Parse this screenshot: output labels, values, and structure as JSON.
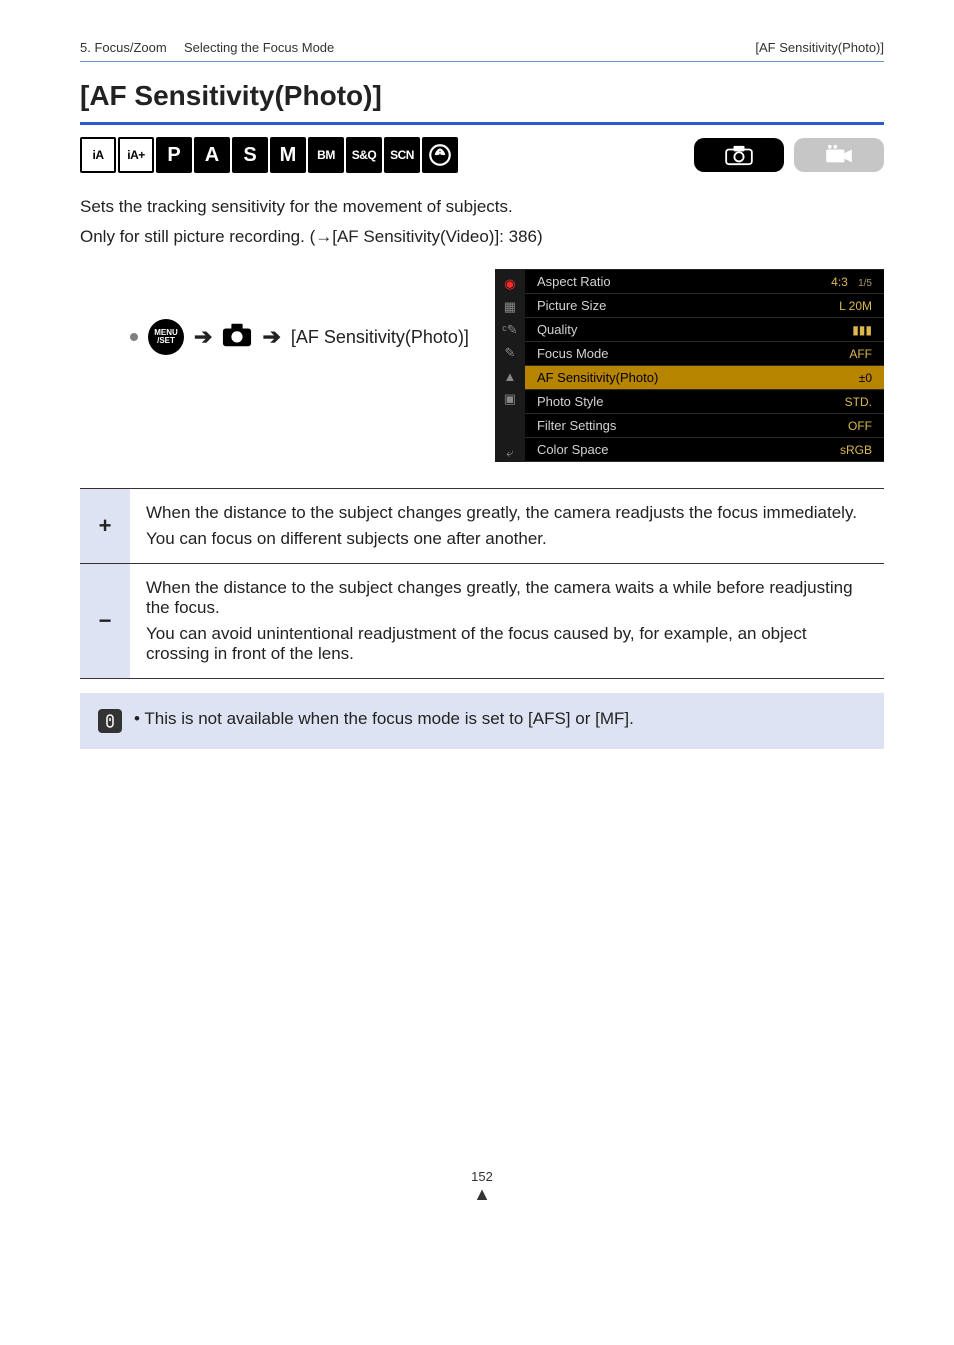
{
  "header": {
    "left": "5. Focus/Zoom",
    "mid": "Selecting the Focus Mode",
    "right": "[AF Sensitivity(Photo)]"
  },
  "title": "[AF Sensitivity(Photo)]",
  "mode_icons": [
    "iA",
    "iA+",
    "P",
    "A",
    "S",
    "M",
    "BM",
    "S&Q",
    "SCN",
    "art"
  ],
  "intro": "Sets the tracking sensitivity for the movement of subjects.",
  "ref_line": {
    "prefix": "Only for still picture recording. (",
    "arrow": "→",
    "link": "[AF Sensitivity(Video)]: 386",
    "suffix": ")"
  },
  "menu_path": {
    "label": "[AF Sensitivity(Photo)]"
  },
  "screenshot": {
    "page": "1/5",
    "rows": [
      {
        "label": "Aspect Ratio",
        "value": "4:3",
        "highlight": false
      },
      {
        "label": "Picture Size",
        "value": "L 20M",
        "highlight": false
      },
      {
        "label": "Quality",
        "value": "▮▮▮",
        "highlight": false
      },
      {
        "label": "Focus Mode",
        "value": "AFF",
        "highlight": false
      },
      {
        "label": "AF Sensitivity(Photo)",
        "value": "±0",
        "highlight": true
      },
      {
        "label": "Photo Style",
        "value": "STD.",
        "highlight": false
      },
      {
        "label": "Filter Settings",
        "value": "OFF",
        "highlight": false
      },
      {
        "label": "Color Space",
        "value": "sRGB",
        "highlight": false
      }
    ]
  },
  "settings": [
    {
      "key": "+",
      "lines": [
        "When the distance to the subject changes greatly, the camera readjusts the focus immediately.",
        "You can focus on different subjects one after another."
      ]
    },
    {
      "key": "−",
      "lines": [
        "When the distance to the subject changes greatly, the camera waits a while before readjusting the focus.",
        "You can avoid unintentional readjustment of the focus caused by, for example, an object crossing in front of the lens."
      ]
    }
  ],
  "note": {
    "bullet": "•",
    "text": "This is not available when the focus mode is set to [AFS] or [MF]."
  },
  "footer": {
    "page": "152",
    "up": "▲"
  }
}
